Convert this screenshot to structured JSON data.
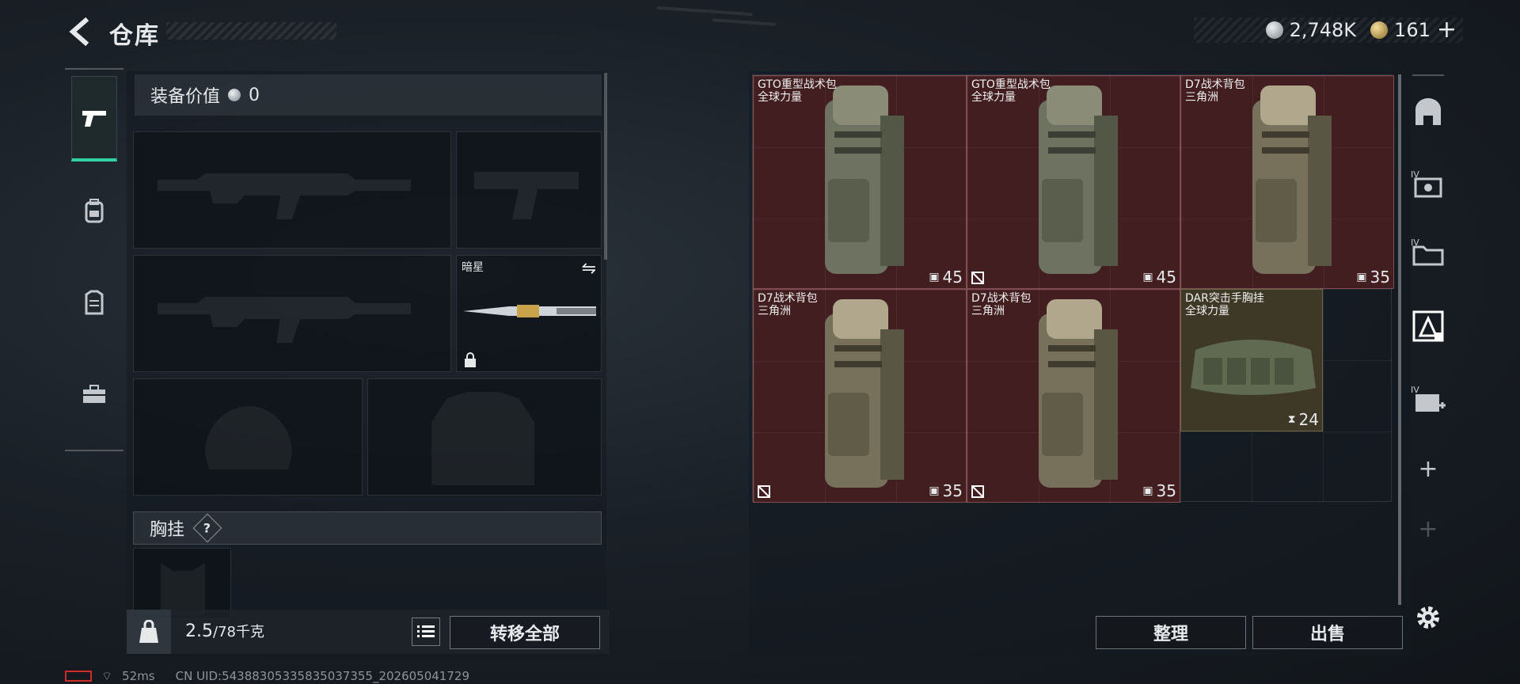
{
  "header": {
    "title": "仓库",
    "currency": [
      {
        "type": "silver",
        "amount": "2,748K"
      },
      {
        "type": "gold",
        "amount": "161"
      }
    ],
    "add_label": "+"
  },
  "left_nav": [
    {
      "name": "weapons",
      "icon": "pistol-icon",
      "active": true
    },
    {
      "name": "backpack",
      "icon": "backpack-icon",
      "active": false
    },
    {
      "name": "armor",
      "icon": "vest-icon",
      "active": false
    },
    {
      "name": "supplies",
      "icon": "toolbox-icon",
      "active": false
    }
  ],
  "equipment": {
    "value_label": "装备价值",
    "value": "0",
    "melee_slot_label": "暗星",
    "chest_rig_label": "胸挂",
    "chest_help": "?"
  },
  "bottom": {
    "weight_current": "2.5",
    "weight_capacity": "/78千克",
    "transfer_all": "转移全部",
    "sort": "整理",
    "sell": "出售"
  },
  "status": {
    "ping": "52ms",
    "uid": "CN UID:543883053358350373​55_202605041729"
  },
  "storage_items": [
    {
      "name": "GTO重型战术包",
      "source": "全球力量",
      "count": "45",
      "color": "red",
      "unusable": false
    },
    {
      "name": "GTO重型战术包",
      "source": "全球力量",
      "count": "45",
      "color": "red",
      "unusable": true
    },
    {
      "name": "D7战术背包",
      "source": "三角洲",
      "count": "35",
      "color": "red",
      "unusable": false
    },
    {
      "name": "D7战术背包",
      "source": "三角洲",
      "count": "35",
      "color": "red",
      "unusable": true
    },
    {
      "name": "D7战术背包",
      "source": "三角洲",
      "count": "35",
      "color": "red",
      "unusable": true
    },
    {
      "name": "DAR突击手胸挂",
      "source": "全球力量",
      "count": "24",
      "color": "brown",
      "unusable": false
    }
  ],
  "right_column": [
    {
      "icon": "bunker-icon"
    },
    {
      "icon": "storage-iv-icon",
      "badge": "IV"
    },
    {
      "icon": "folder-iv-icon",
      "badge": "IV"
    },
    {
      "icon": "storage-selected-icon"
    },
    {
      "icon": "medkit-iv-icon",
      "badge": "IV"
    },
    {
      "icon": "add-storage-icon",
      "label": "+"
    },
    {
      "icon": "add-storage-disabled-icon",
      "label": "+"
    }
  ],
  "colors": {
    "accent": "#33d2a5",
    "item_red": "#421e21",
    "item_brown": "#3e3826"
  }
}
